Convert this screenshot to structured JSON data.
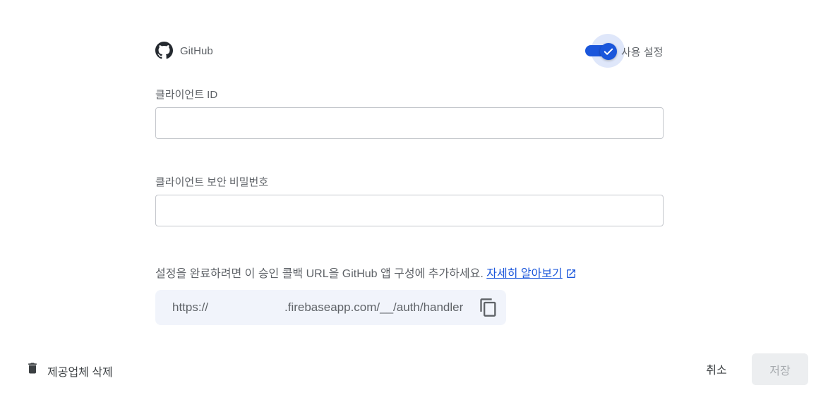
{
  "provider": {
    "name": "GitHub",
    "icon": "github-icon",
    "enabled": true,
    "toggle_label": "사용 설정"
  },
  "fields": {
    "client_id": {
      "label": "클라이언트 ID",
      "value": ""
    },
    "client_secret": {
      "label": "클라이언트 보안 비밀번호",
      "value": ""
    }
  },
  "info": {
    "text": "설정을 완료하려면 이 승인 콜백 URL을 GitHub 앱 구성에 추가하세요.",
    "link_text": "자세히 알아보기",
    "link_icon": "external-link-icon"
  },
  "callback_url": {
    "prefix": "https://",
    "suffix": ".firebaseapp.com/__/auth/handler",
    "copy_icon": "copy-icon"
  },
  "footer": {
    "delete_label": "제공업체 삭제",
    "delete_icon": "trash-icon",
    "cancel_label": "취소",
    "save_label": "저장"
  },
  "colors": {
    "accent": "#1a56db",
    "url_background": "#f1f4fb",
    "disabled_button": "#eceef0"
  }
}
